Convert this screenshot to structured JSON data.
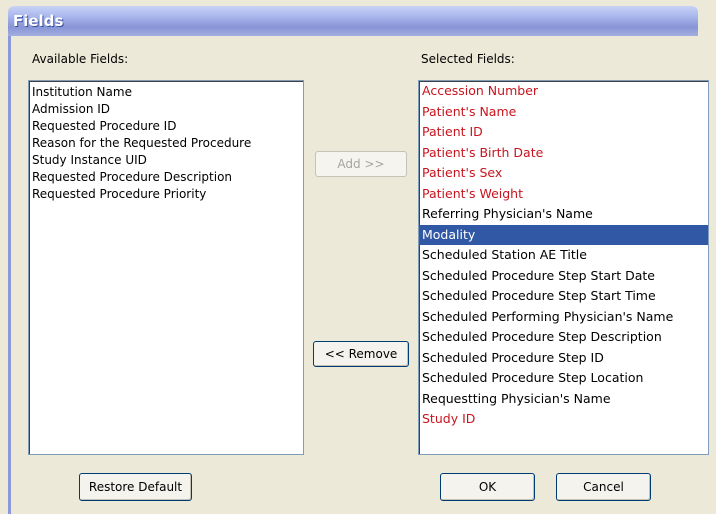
{
  "window": {
    "title": "Fields"
  },
  "available": {
    "label": "Available Fields:",
    "items": [
      "Institution Name",
      "Admission ID",
      "Requested Procedure ID",
      "Reason for the Requested Procedure",
      "Study Instance UID",
      "Requested Procedure Description",
      "Requested Procedure Priority"
    ]
  },
  "selected": {
    "label": "Selected Fields:",
    "items": [
      {
        "text": "Accession Number",
        "required": true
      },
      {
        "text": "Patient's Name",
        "required": true
      },
      {
        "text": "Patient ID",
        "required": true
      },
      {
        "text": "Patient's Birth Date",
        "required": true
      },
      {
        "text": "Patient's Sex",
        "required": true
      },
      {
        "text": "Patient's Weight",
        "required": true
      },
      {
        "text": "Referring Physician's Name",
        "required": false
      },
      {
        "text": "Modality",
        "required": false,
        "selected": true
      },
      {
        "text": "Scheduled Station AE Title",
        "required": false
      },
      {
        "text": "Scheduled Procedure Step Start Date",
        "required": false
      },
      {
        "text": "Scheduled Procedure Step Start Time",
        "required": false
      },
      {
        "text": "Scheduled Performing Physician's Name",
        "required": false
      },
      {
        "text": "Scheduled Procedure Step Description",
        "required": false
      },
      {
        "text": "Scheduled Procedure Step ID",
        "required": false
      },
      {
        "text": "Scheduled Procedure Step Location",
        "required": false
      },
      {
        "text": "Requestting Physician's Name",
        "required": false
      },
      {
        "text": "Study ID",
        "required": true
      }
    ]
  },
  "buttons": {
    "add": "Add >>",
    "remove": "<< Remove",
    "restore": "Restore Default",
    "ok": "OK",
    "cancel": "Cancel"
  },
  "colors": {
    "required_text": "#c8141e",
    "selection_bg": "#3158a5"
  }
}
